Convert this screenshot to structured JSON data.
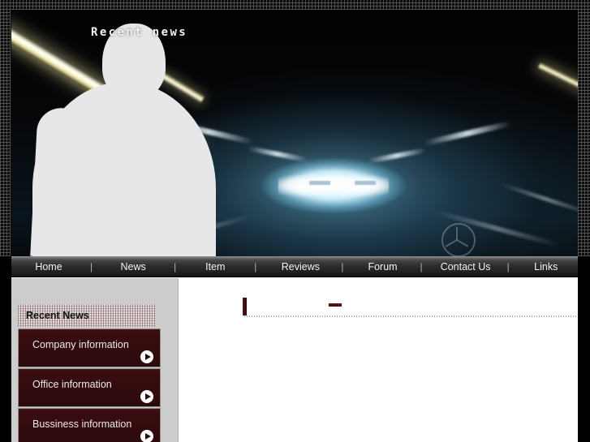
{
  "page": {
    "title": "Recent news",
    "accent_color": "#3a0c0f",
    "nav_bg": "#242424",
    "sidebar_bg": "#cccccc",
    "content_bg": "#ffffff"
  },
  "hero": {
    "title": "Recent news",
    "icons": {
      "silhouette": "person-silhouette",
      "emblem": "car-emblem-icon"
    }
  },
  "nav": {
    "items": [
      {
        "label": "Home"
      },
      {
        "label": "News"
      },
      {
        "label": "Item"
      },
      {
        "label": "Reviews"
      },
      {
        "label": "Forum"
      },
      {
        "label": "Contact Us"
      },
      {
        "label": "Links"
      }
    ],
    "separator": "|"
  },
  "sidebar": {
    "heading": "Recent News",
    "items": [
      {
        "label": "Company information",
        "icon": "play-arrow-icon"
      },
      {
        "label": "Office information",
        "icon": "play-arrow-icon"
      },
      {
        "label": "Bussiness information",
        "icon": "play-arrow-icon"
      }
    ]
  },
  "main": {
    "dash": "",
    "heading": ""
  }
}
